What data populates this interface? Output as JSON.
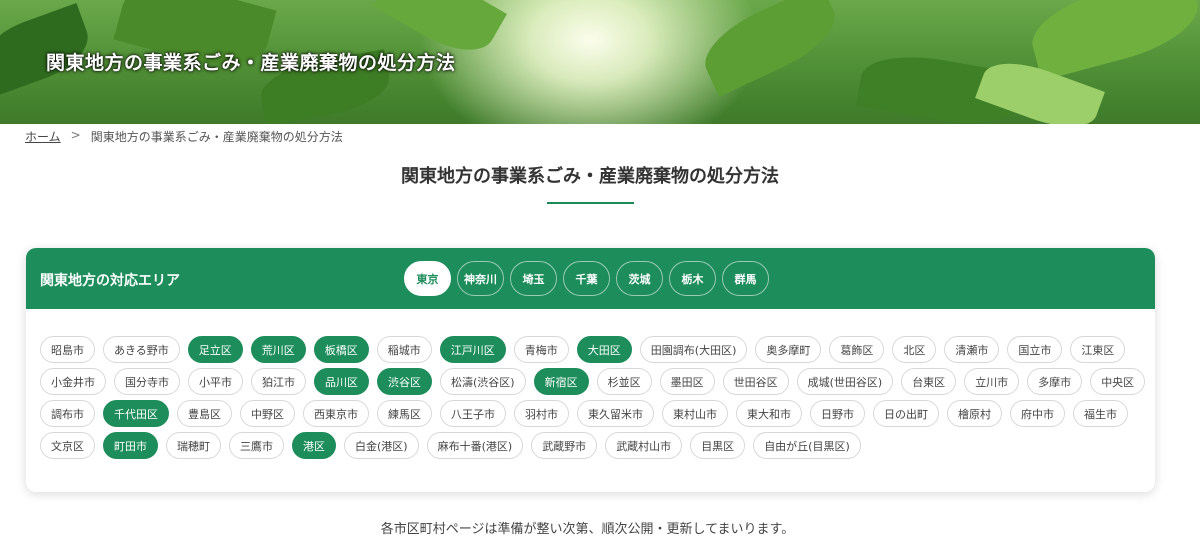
{
  "hero": {
    "title": "関東地方の事業系ごみ・産業廃棄物の処分方法"
  },
  "breadcrumb": {
    "home": "ホーム",
    "separator": ">",
    "current": "関東地方の事業系ごみ・産業廃棄物の処分方法"
  },
  "page": {
    "title": "関東地方の事業系ごみ・産業廃棄物の処分方法",
    "note": "各市区町村ページは準備が整い次第、順次公開・更新してまいります。"
  },
  "area": {
    "label": "関東地方の対応エリア",
    "prefectures": [
      {
        "label": "東京",
        "active": true
      },
      {
        "label": "神奈川",
        "active": false
      },
      {
        "label": "埼玉",
        "active": false
      },
      {
        "label": "千葉",
        "active": false
      },
      {
        "label": "茨城",
        "active": false
      },
      {
        "label": "栃木",
        "active": false
      },
      {
        "label": "群馬",
        "active": false
      }
    ],
    "municipalities": [
      {
        "label": "昭島市",
        "active": false
      },
      {
        "label": "あきる野市",
        "active": false
      },
      {
        "label": "足立区",
        "active": true
      },
      {
        "label": "荒川区",
        "active": true
      },
      {
        "label": "板橋区",
        "active": true
      },
      {
        "label": "稲城市",
        "active": false
      },
      {
        "label": "江戸川区",
        "active": true
      },
      {
        "label": "青梅市",
        "active": false
      },
      {
        "label": "大田区",
        "active": true
      },
      {
        "label": "田園調布(大田区)",
        "active": false
      },
      {
        "label": "奥多摩町",
        "active": false
      },
      {
        "label": "葛飾区",
        "active": false
      },
      {
        "label": "北区",
        "active": false
      },
      {
        "label": "清瀬市",
        "active": false
      },
      {
        "label": "国立市",
        "active": false
      },
      {
        "label": "江東区",
        "active": false
      },
      {
        "label": "小金井市",
        "active": false
      },
      {
        "label": "国分寺市",
        "active": false
      },
      {
        "label": "小平市",
        "active": false
      },
      {
        "label": "狛江市",
        "active": false
      },
      {
        "label": "品川区",
        "active": true
      },
      {
        "label": "渋谷区",
        "active": true
      },
      {
        "label": "松濤(渋谷区)",
        "active": false
      },
      {
        "label": "新宿区",
        "active": true
      },
      {
        "label": "杉並区",
        "active": false
      },
      {
        "label": "墨田区",
        "active": false
      },
      {
        "label": "世田谷区",
        "active": false
      },
      {
        "label": "成城(世田谷区)",
        "active": false
      },
      {
        "label": "台東区",
        "active": false
      },
      {
        "label": "立川市",
        "active": false
      },
      {
        "label": "多摩市",
        "active": false
      },
      {
        "label": "中央区",
        "active": false
      },
      {
        "label": "調布市",
        "active": false
      },
      {
        "label": "千代田区",
        "active": true
      },
      {
        "label": "豊島区",
        "active": false
      },
      {
        "label": "中野区",
        "active": false
      },
      {
        "label": "西東京市",
        "active": false
      },
      {
        "label": "練馬区",
        "active": false
      },
      {
        "label": "八王子市",
        "active": false
      },
      {
        "label": "羽村市",
        "active": false
      },
      {
        "label": "東久留米市",
        "active": false
      },
      {
        "label": "東村山市",
        "active": false
      },
      {
        "label": "東大和市",
        "active": false
      },
      {
        "label": "日野市",
        "active": false
      },
      {
        "label": "日の出町",
        "active": false
      },
      {
        "label": "檜原村",
        "active": false
      },
      {
        "label": "府中市",
        "active": false
      },
      {
        "label": "福生市",
        "active": false
      },
      {
        "label": "文京区",
        "active": false
      },
      {
        "label": "町田市",
        "active": true
      },
      {
        "label": "瑞穂町",
        "active": false
      },
      {
        "label": "三鷹市",
        "active": false
      },
      {
        "label": "港区",
        "active": true
      },
      {
        "label": "白金(港区)",
        "active": false
      },
      {
        "label": "麻布十番(港区)",
        "active": false
      },
      {
        "label": "武蔵野市",
        "active": false
      },
      {
        "label": "武蔵村山市",
        "active": false
      },
      {
        "label": "目黒区",
        "active": false
      },
      {
        "label": "自由が丘(目黒区)",
        "active": false
      }
    ]
  },
  "colors": {
    "accent": "#1d8d5b",
    "rule": "#1a8a56"
  }
}
